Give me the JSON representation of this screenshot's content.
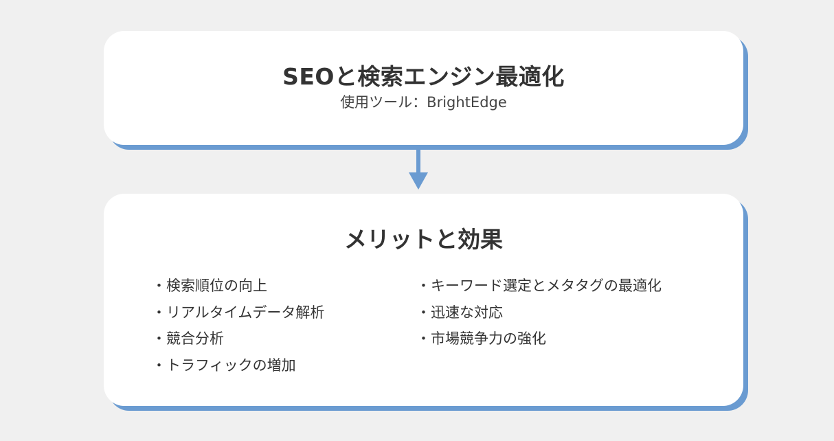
{
  "top_box": {
    "title": "SEOと検索エンジン最適化",
    "subtitle": "使用ツール：BrightEdge"
  },
  "bottom_box": {
    "title": "メリットと効果",
    "left_items": [
      "・検索順位の向上",
      "・リアルタイムデータ解析",
      "・競合分析",
      "・トラフィックの増加"
    ],
    "right_items": [
      "・キーワード選定とメタタグの最適化",
      "・迅速な対応",
      "・市場競争力の強化"
    ]
  },
  "colors": {
    "background": "#f0f0f0",
    "card": "#ffffff",
    "accent": "#6a9bd1",
    "text": "#333333"
  }
}
